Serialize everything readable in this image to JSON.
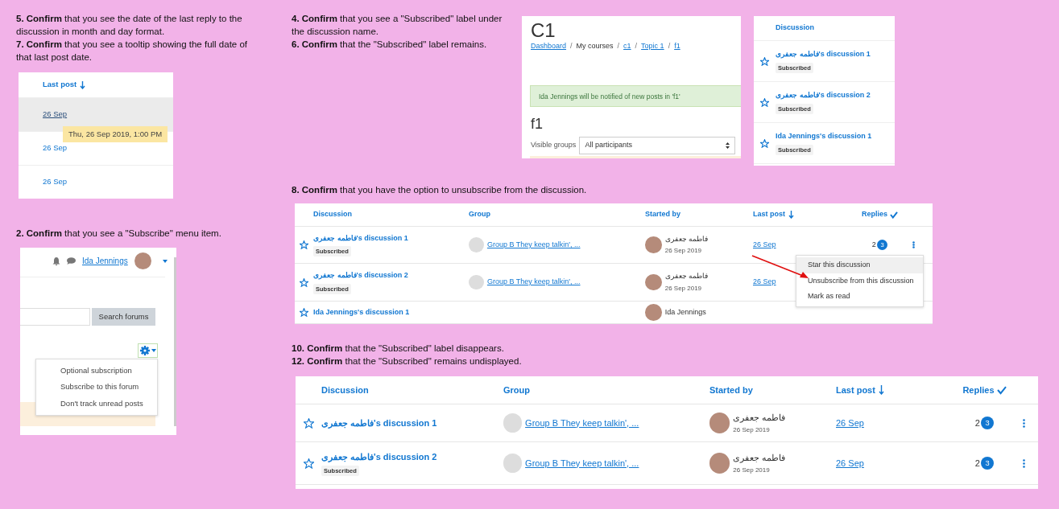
{
  "tooltip_example": {
    "instructions": [
      "**5. Confirm** that you see the date of the last reply to the discussion in month and day format.",
      "**7. Confirm** that you see a tooltip showing the full date of that last post date."
    ],
    "header": "Last post",
    "rows": [
      {
        "date": "26 Sep",
        "hovered": true
      },
      {
        "date": "26 Sep",
        "hovered": false
      },
      {
        "date": "26 Sep",
        "hovered": false
      }
    ],
    "tooltip": "Thu, 26 Sep 2019, 1:00 PM"
  },
  "course_example": {
    "instructions": [
      "**4. Confirm** that you see a \"Subscribed\" label under the discussion name.",
      "**6. Confirm** that the \"Subscribed\" label remains."
    ],
    "title": "C1",
    "separator": "/",
    "breadcrumb": [
      {
        "label": "Dashboard",
        "link": true
      },
      {
        "label": "My courses",
        "link": false
      },
      {
        "label": "c1",
        "link": true
      },
      {
        "label": "Topic 1",
        "link": true
      },
      {
        "label": "f1",
        "link": true
      }
    ],
    "alert": "Ida Jennings will be notified of new posts in 'f1'",
    "forum_title": "f1",
    "groups_label": "Visible groups",
    "groups_value": "All participants"
  },
  "subscribed_list_example": {
    "header": "Discussion",
    "rows": [
      {
        "title": "فاطمه جعفری's discussion 1",
        "badge": "Subscribed"
      },
      {
        "title": "فاطمه جعفری's discussion 2",
        "badge": "Subscribed"
      },
      {
        "title": "Ida Jennings's discussion 1",
        "badge": "Subscribed"
      }
    ]
  },
  "menu_example": {
    "instructions": [
      "**2. Confirm** that you see a \"Subscribe\" menu item."
    ],
    "user": "Ida Jennings",
    "search_button": "Search forums",
    "menu_items": [
      "Optional subscription",
      "Subscribe to this forum",
      "Don't track unread posts"
    ]
  },
  "unsubscribe_example": {
    "instructions": [
      "**8. Confirm** that you have the option to unsubscribe from the discussion."
    ],
    "columns": [
      {
        "label": "Discussion",
        "kind": "plain"
      },
      {
        "label": "Group",
        "kind": "plain"
      },
      {
        "label": "Started by",
        "kind": "plain"
      },
      {
        "label": "Last post",
        "kind": "sort"
      },
      {
        "label": "Replies",
        "kind": "check"
      }
    ],
    "rows": [
      {
        "title": "فاطمه جعفری's discussion 1",
        "badge": "Subscribed",
        "group": "Group B They keep talkin', ...",
        "author": "فاطمه جعفری",
        "started": "26 Sep 2019",
        "last_post": "26 Sep",
        "replies": "2",
        "unread": "3",
        "menu": true
      },
      {
        "title": "فاطمه جعفری's discussion 2",
        "badge": "Subscribed",
        "group": "Group B They keep talkin', ...",
        "author": "فاطمه جعفری",
        "started": "26 Sep 2019",
        "last_post": "26 Sep"
      },
      {
        "title": "Ida Jennings's discussion 1",
        "author": "Ida Jennings"
      }
    ],
    "row_menu": [
      {
        "label": "Star this discussion",
        "highlighted": true
      },
      {
        "label": "Unsubscribe from this discussion",
        "highlighted": false
      },
      {
        "label": "Mark as read",
        "highlighted": false
      }
    ]
  },
  "unsubscribed_example": {
    "instructions": [
      "**10. Confirm** that the \"Subscribed\" label disappears.",
      "**12. Confirm** that the \"Subscribed\" remains undisplayed."
    ],
    "columns": [
      {
        "label": "Discussion",
        "kind": "plain"
      },
      {
        "label": "Group",
        "kind": "plain"
      },
      {
        "label": "Started by",
        "kind": "plain"
      },
      {
        "label": "Last post",
        "kind": "sort"
      },
      {
        "label": "Replies",
        "kind": "check"
      }
    ],
    "rows": [
      {
        "title": "فاطمه جعفری's discussion 1",
        "group": "Group B They keep talkin', ...",
        "author": "فاطمه جعفری",
        "started": "26 Sep 2019",
        "last_post": "26 Sep",
        "replies": "2",
        "unread": "3",
        "menu": true
      },
      {
        "title": "فاطمه جعفری's discussion 2",
        "badge": "Subscribed",
        "group": "Group B They keep talkin', ...",
        "author": "فاطمه جعفری",
        "started": "26 Sep 2019",
        "last_post": "26 Sep",
        "replies": "2",
        "unread": "3",
        "menu": true
      }
    ]
  }
}
